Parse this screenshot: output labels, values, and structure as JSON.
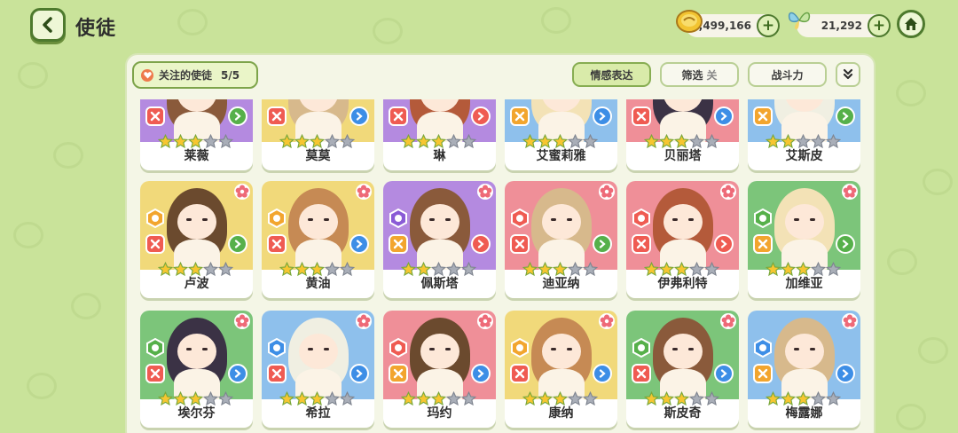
{
  "header": {
    "title": "使徒",
    "gold": "2,499,166",
    "butterfly": "21,292"
  },
  "toolbar": {
    "follow_label": "关注的使徒",
    "follow_count": "5/5",
    "emotion_label": "情感表达",
    "filter_label": "筛选",
    "filter_state": "关",
    "power_label": "战斗力"
  },
  "colors": {
    "purple": "#b48ae0",
    "yellow": "#f1d97a",
    "blue": "#8ec0ec",
    "red": "#ef8f98",
    "green": "#7cc57a",
    "accent_green": "#4e7a2e"
  },
  "rows": [
    [
      {
        "name": "莱薇",
        "bg": "purple",
        "stars": 3,
        "elem": "none",
        "role": "red",
        "arrow": "green",
        "flower": false
      },
      {
        "name": "莫莫",
        "bg": "yellow",
        "stars": 3,
        "elem": "none",
        "role": "red",
        "arrow": "blue",
        "flower": false
      },
      {
        "name": "琳",
        "bg": "purple",
        "stars": 3,
        "elem": "none",
        "role": "red",
        "arrow": "red",
        "flower": false
      },
      {
        "name": "艾蜜莉雅",
        "bg": "blue",
        "stars": 3,
        "elem": "none",
        "role": "yellow",
        "arrow": "blue",
        "flower": false
      },
      {
        "name": "贝丽塔",
        "bg": "red",
        "stars": 3,
        "elem": "none",
        "role": "red",
        "arrow": "blue",
        "flower": false
      },
      {
        "name": "艾斯皮",
        "bg": "blue",
        "stars": 2,
        "elem": "none",
        "role": "yellow",
        "arrow": "green",
        "flower": false
      }
    ],
    [
      {
        "name": "卢波",
        "bg": "yellow",
        "stars": 3,
        "elem": "yellow",
        "role": "red",
        "arrow": "green",
        "flower": true
      },
      {
        "name": "黄油",
        "bg": "yellow",
        "stars": 3,
        "elem": "yellow",
        "role": "red",
        "arrow": "blue",
        "flower": true
      },
      {
        "name": "佩斯塔",
        "bg": "purple",
        "stars": 2,
        "elem": "purple",
        "role": "yellow",
        "arrow": "red",
        "flower": true
      },
      {
        "name": "迪亚纳",
        "bg": "red",
        "stars": 3,
        "elem": "red",
        "role": "red",
        "arrow": "green",
        "flower": true
      },
      {
        "name": "伊弗利特",
        "bg": "red",
        "stars": 3,
        "elem": "red",
        "role": "red",
        "arrow": "red",
        "flower": true
      },
      {
        "name": "加维亚",
        "bg": "green",
        "stars": 3,
        "elem": "green",
        "role": "yellow",
        "arrow": "green",
        "flower": true
      }
    ],
    [
      {
        "name": "埃尔芬",
        "bg": "green",
        "stars": 3,
        "elem": "green",
        "role": "red",
        "arrow": "blue",
        "flower": true
      },
      {
        "name": "希拉",
        "bg": "blue",
        "stars": 3,
        "elem": "blue",
        "role": "red",
        "arrow": "blue",
        "flower": true
      },
      {
        "name": "玛约",
        "bg": "red",
        "stars": 3,
        "elem": "red",
        "role": "yellow",
        "arrow": "blue",
        "flower": true
      },
      {
        "name": "康纳",
        "bg": "yellow",
        "stars": 3,
        "elem": "yellow",
        "role": "red",
        "arrow": "blue",
        "flower": true
      },
      {
        "name": "斯皮奇",
        "bg": "green",
        "stars": 3,
        "elem": "green",
        "role": "red",
        "arrow": "blue",
        "flower": true
      },
      {
        "name": "梅露娜",
        "bg": "blue",
        "stars": 3,
        "elem": "blue",
        "role": "yellow",
        "arrow": "blue",
        "flower": true
      }
    ]
  ],
  "icons": {
    "back": "chevron-left-icon",
    "gold": "gold-coin-icon",
    "butterfly": "butterfly-icon",
    "home": "home-icon",
    "heart": "heart-icon",
    "expand": "chevron-double-down-icon"
  }
}
